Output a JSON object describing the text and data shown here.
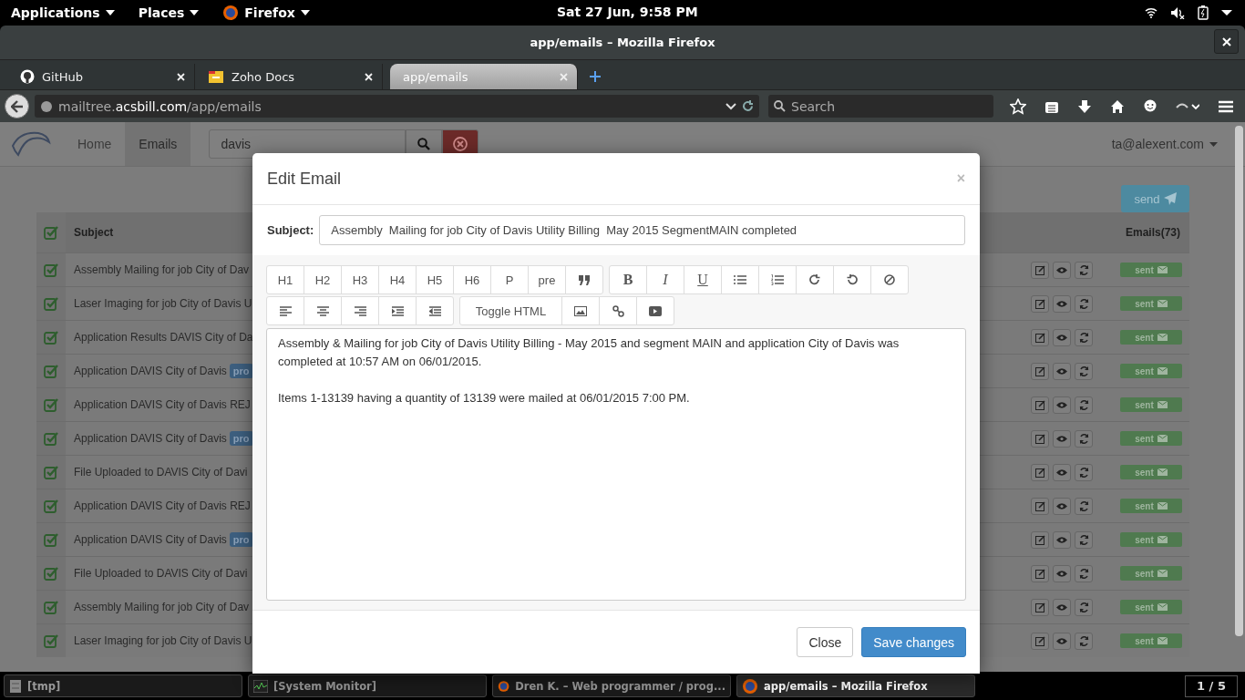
{
  "top_panel": {
    "menus": [
      "Applications",
      "Places",
      "Firefox"
    ],
    "clock": "Sat 27 Jun, 9:58 PM"
  },
  "window": {
    "title": "app/emails – Mozilla Firefox"
  },
  "tabs": [
    {
      "label": "GitHub",
      "selected": false
    },
    {
      "label": "Zoho Docs",
      "selected": false
    },
    {
      "label": "app/emails",
      "selected": true
    }
  ],
  "address_bar": {
    "url_host": "mailtree.",
    "url_domain": "acsbill.com",
    "url_path": "/app/emails"
  },
  "search_bar": {
    "placeholder": "Search"
  },
  "app_nav": {
    "items": [
      {
        "label": "Home",
        "selected": false
      },
      {
        "label": "Emails",
        "selected": true
      }
    ],
    "search_value": "davis",
    "user": "ta@alexent.com"
  },
  "send_button": "send",
  "table": {
    "columns": [
      "Subject",
      "Emails(73)"
    ],
    "header_checked": true,
    "rows": [
      {
        "checked": true,
        "subject": "Assembly Mailing for job City of Dav",
        "badge": "",
        "status": "sent"
      },
      {
        "checked": true,
        "subject": "Laser Imaging for job City of Davis U",
        "badge": "",
        "status": "sent"
      },
      {
        "checked": true,
        "subject": "Application Results DAVIS City of Da",
        "badge": "",
        "status": "sent"
      },
      {
        "checked": true,
        "subject": "Application DAVIS City of Davis",
        "badge": "pro",
        "status": "sent"
      },
      {
        "checked": true,
        "subject": "Application DAVIS City of Davis REJ",
        "badge": "",
        "status": "sent"
      },
      {
        "checked": true,
        "subject": "Application DAVIS City of Davis",
        "badge": "pro",
        "status": "sent"
      },
      {
        "checked": true,
        "subject": "File Uploaded to DAVIS City of Davi",
        "badge": "",
        "status": "sent"
      },
      {
        "checked": true,
        "subject": "Application DAVIS City of Davis REJ",
        "badge": "",
        "status": "sent"
      },
      {
        "checked": true,
        "subject": "Application DAVIS City of Davis",
        "badge": "pro",
        "status": "sent"
      },
      {
        "checked": true,
        "subject": "File Uploaded to DAVIS City of Davi",
        "badge": "",
        "status": "sent"
      },
      {
        "checked": true,
        "subject": "Assembly Mailing for job City of Dav",
        "badge": "",
        "status": "sent"
      },
      {
        "checked": true,
        "subject": "Laser Imaging for job City of Davis U",
        "badge": "",
        "status": "sent"
      }
    ]
  },
  "modal": {
    "title": "Edit Email",
    "close_glyph": "×",
    "subject_label": "Subject:",
    "subject_value": "Assembly  Mailing for job City of Davis Utility Billing  May 2015 SegmentMAIN completed",
    "heading_buttons": [
      "H1",
      "H2",
      "H3",
      "H4",
      "H5",
      "H6",
      "P",
      "pre"
    ],
    "style_buttons": [
      "B",
      "I",
      "U"
    ],
    "toggle_html": "Toggle HTML",
    "body": [
      "Assembly & Mailing for job City of Davis Utility Billing - May 2015 and segment MAIN and application City of Davis was completed at 10:57 AM on 06/01/2015.",
      "Items 1-13139 having a quantity of 13139 were mailed at 06/01/2015 7:00 PM."
    ],
    "buttons": [
      "Close",
      "Save changes"
    ]
  },
  "taskbar": {
    "items": [
      {
        "label": "[tmp]",
        "selected": false
      },
      {
        "label": "[System Monitor]",
        "selected": false
      },
      {
        "label": "Dren K. – Web programmer / prog...",
        "selected": false
      },
      {
        "label": "app/emails – Mozilla Firefox",
        "selected": true
      }
    ],
    "workspace": "1 / 5"
  }
}
